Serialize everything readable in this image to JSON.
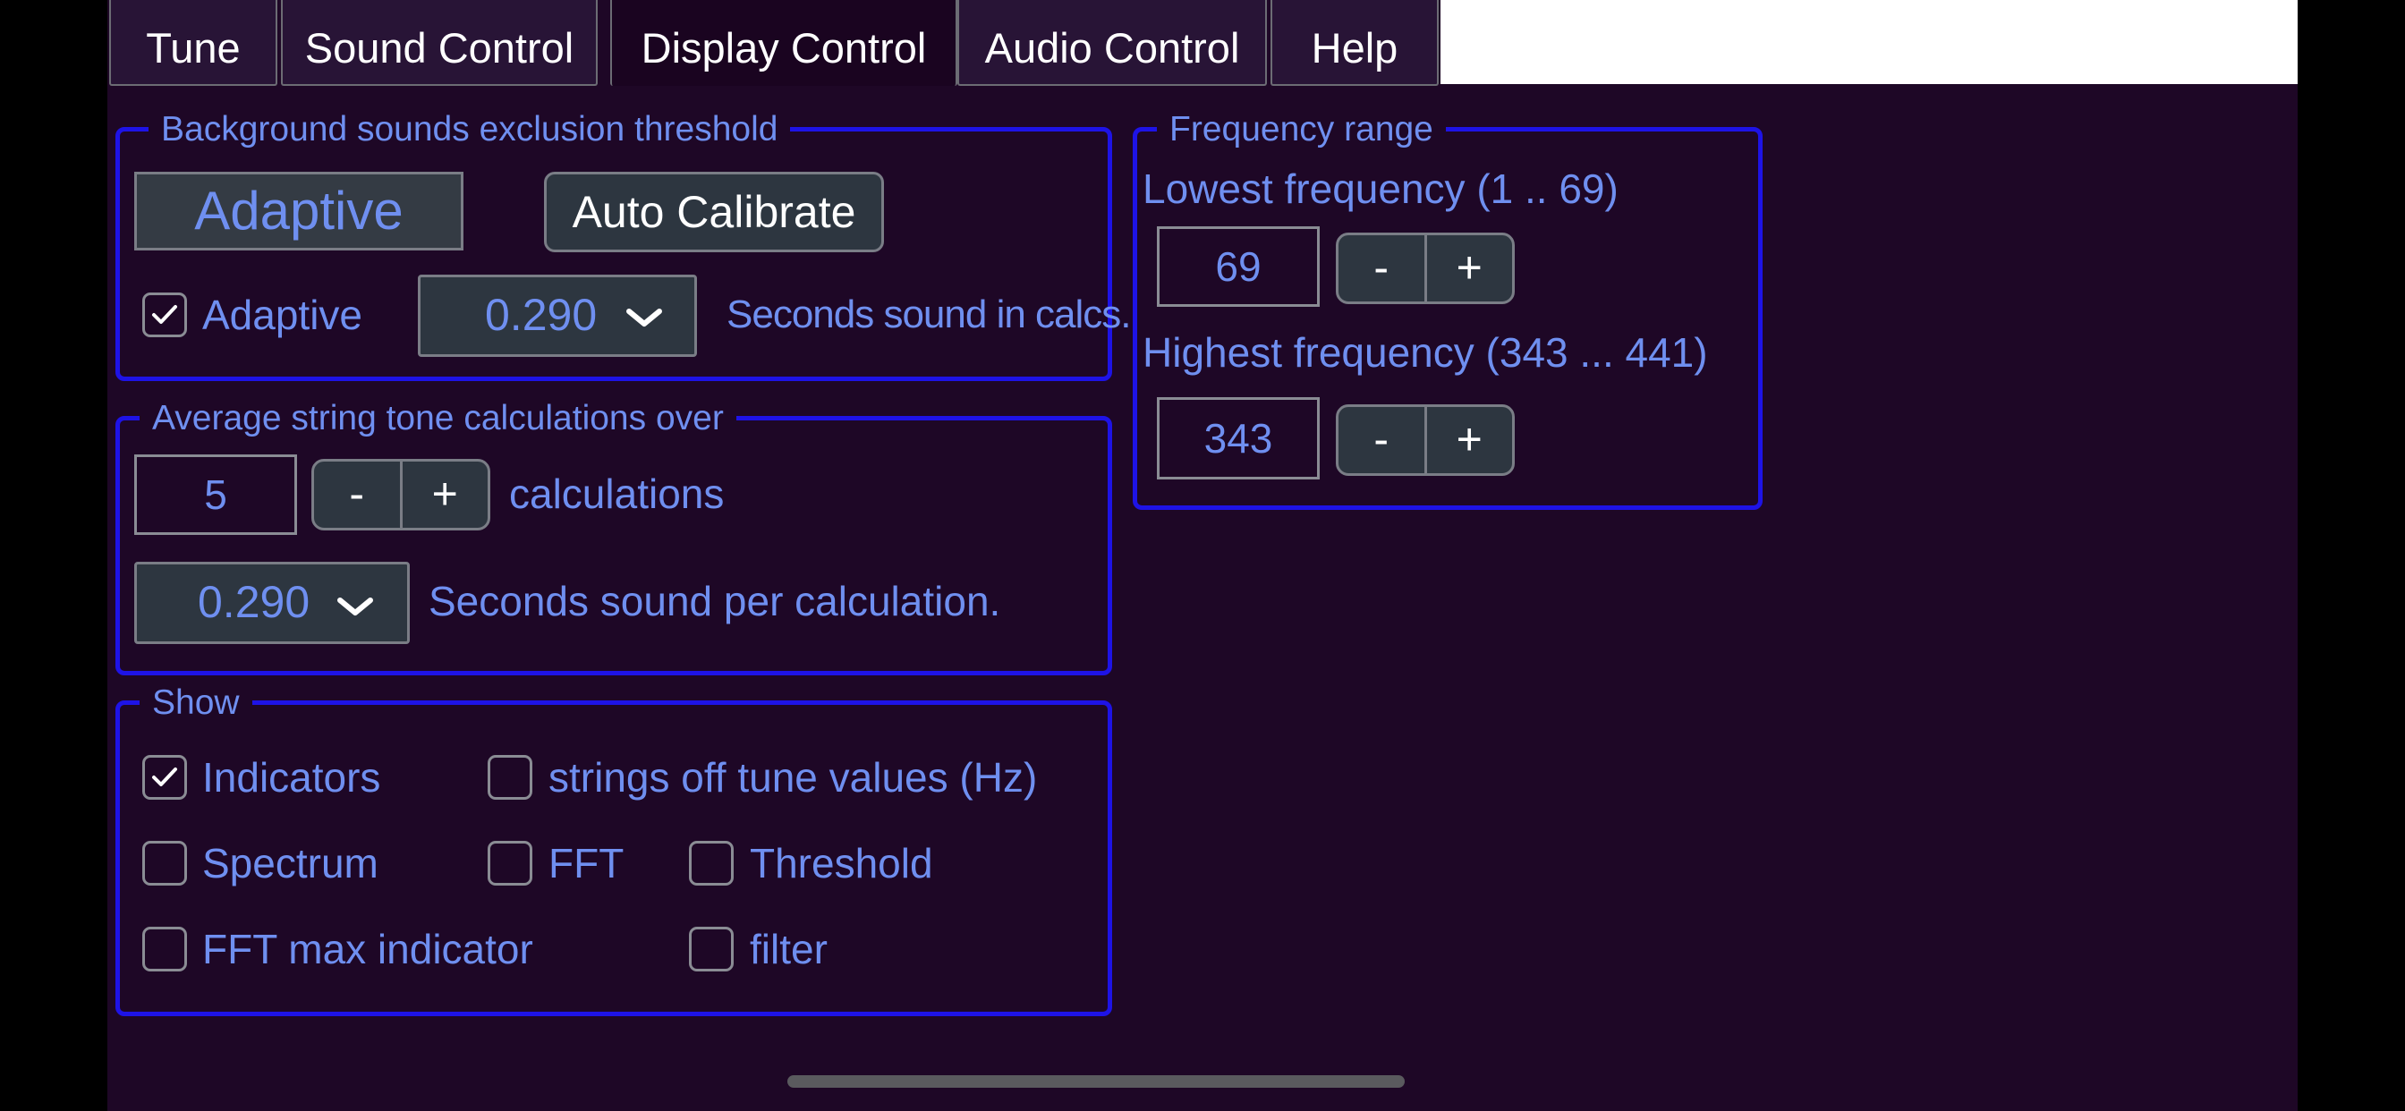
{
  "tabs": [
    {
      "label": "Tune",
      "active": false
    },
    {
      "label": "Sound Control",
      "active": false
    },
    {
      "label": "Display Control",
      "active": true
    },
    {
      "label": "Audio Control",
      "active": false
    },
    {
      "label": "Help",
      "active": false
    }
  ],
  "background": {
    "legend": "Background sounds exclusion threshold",
    "mode_button": "Adaptive",
    "calibrate_button": "Auto Calibrate",
    "adaptive_checkbox": {
      "label": "Adaptive",
      "checked": true
    },
    "seconds_select": "0.290",
    "seconds_label": "Seconds sound in calcs."
  },
  "average": {
    "legend": "Average string tone calculations over",
    "count_value": "5",
    "minus": "-",
    "plus": "+",
    "count_label": "calculations",
    "seconds_select": "0.290",
    "seconds_label": "Seconds sound per calculation."
  },
  "show": {
    "legend": "Show",
    "options": {
      "indicators": {
        "label": "Indicators",
        "checked": true
      },
      "strings_off": {
        "label": "strings off tune values (Hz)",
        "checked": false
      },
      "spectrum": {
        "label": "Spectrum",
        "checked": false
      },
      "fft": {
        "label": "FFT",
        "checked": false
      },
      "threshold": {
        "label": "Threshold",
        "checked": false
      },
      "fft_max": {
        "label": "FFT max indicator",
        "checked": false
      },
      "filter": {
        "label": "filter",
        "checked": false
      }
    }
  },
  "frequency": {
    "legend": "Frequency range",
    "lowest_label": "Lowest frequency (1 .. 69)",
    "lowest_value": "69",
    "highest_label": "Highest frequency (343 ... 441)",
    "highest_value": "343",
    "minus": "-",
    "plus": "+"
  },
  "colors": {
    "background": "#1e0726",
    "text": "#6f8ff0",
    "frame": "#1e13e6",
    "button": "#2d3640"
  }
}
